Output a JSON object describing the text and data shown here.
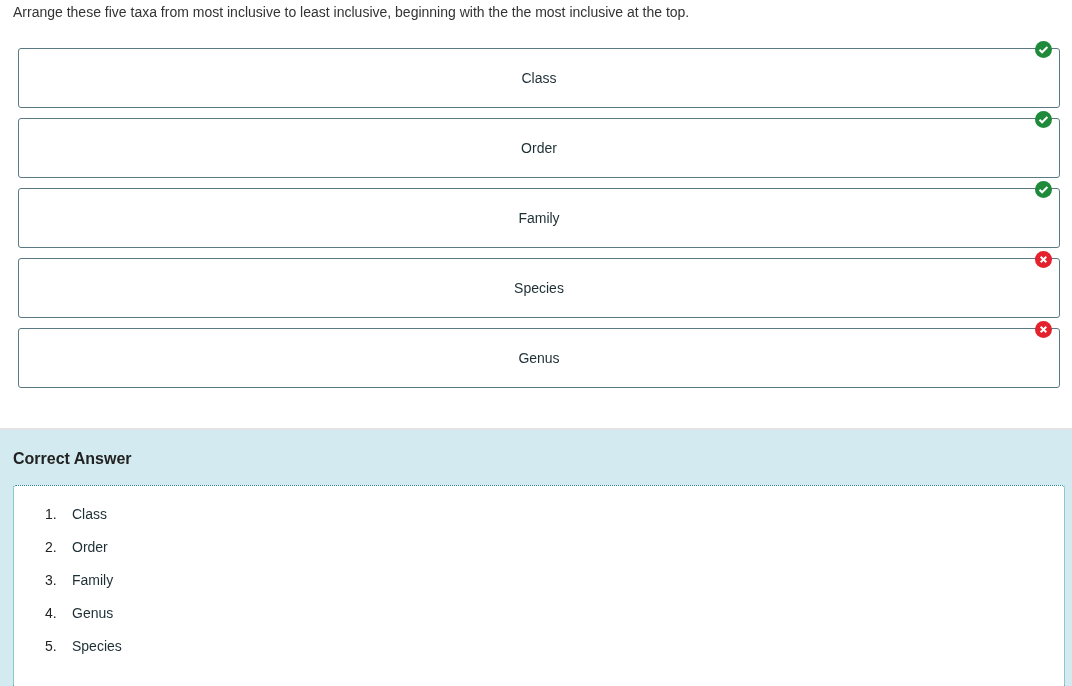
{
  "question": "Arrange these five taxa from most inclusive to least inclusive, beginning with the the most inclusive at the top.",
  "items": [
    {
      "label": "Class",
      "correct": true
    },
    {
      "label": "Order",
      "correct": true
    },
    {
      "label": "Family",
      "correct": true
    },
    {
      "label": "Species",
      "correct": false
    },
    {
      "label": "Genus",
      "correct": false
    }
  ],
  "correct_answer": {
    "heading": "Correct Answer",
    "items": [
      {
        "number": "1.",
        "label": "Class"
      },
      {
        "number": "2.",
        "label": "Order"
      },
      {
        "number": "3.",
        "label": "Family"
      },
      {
        "number": "4.",
        "label": "Genus"
      },
      {
        "number": "5.",
        "label": "Species"
      }
    ]
  }
}
